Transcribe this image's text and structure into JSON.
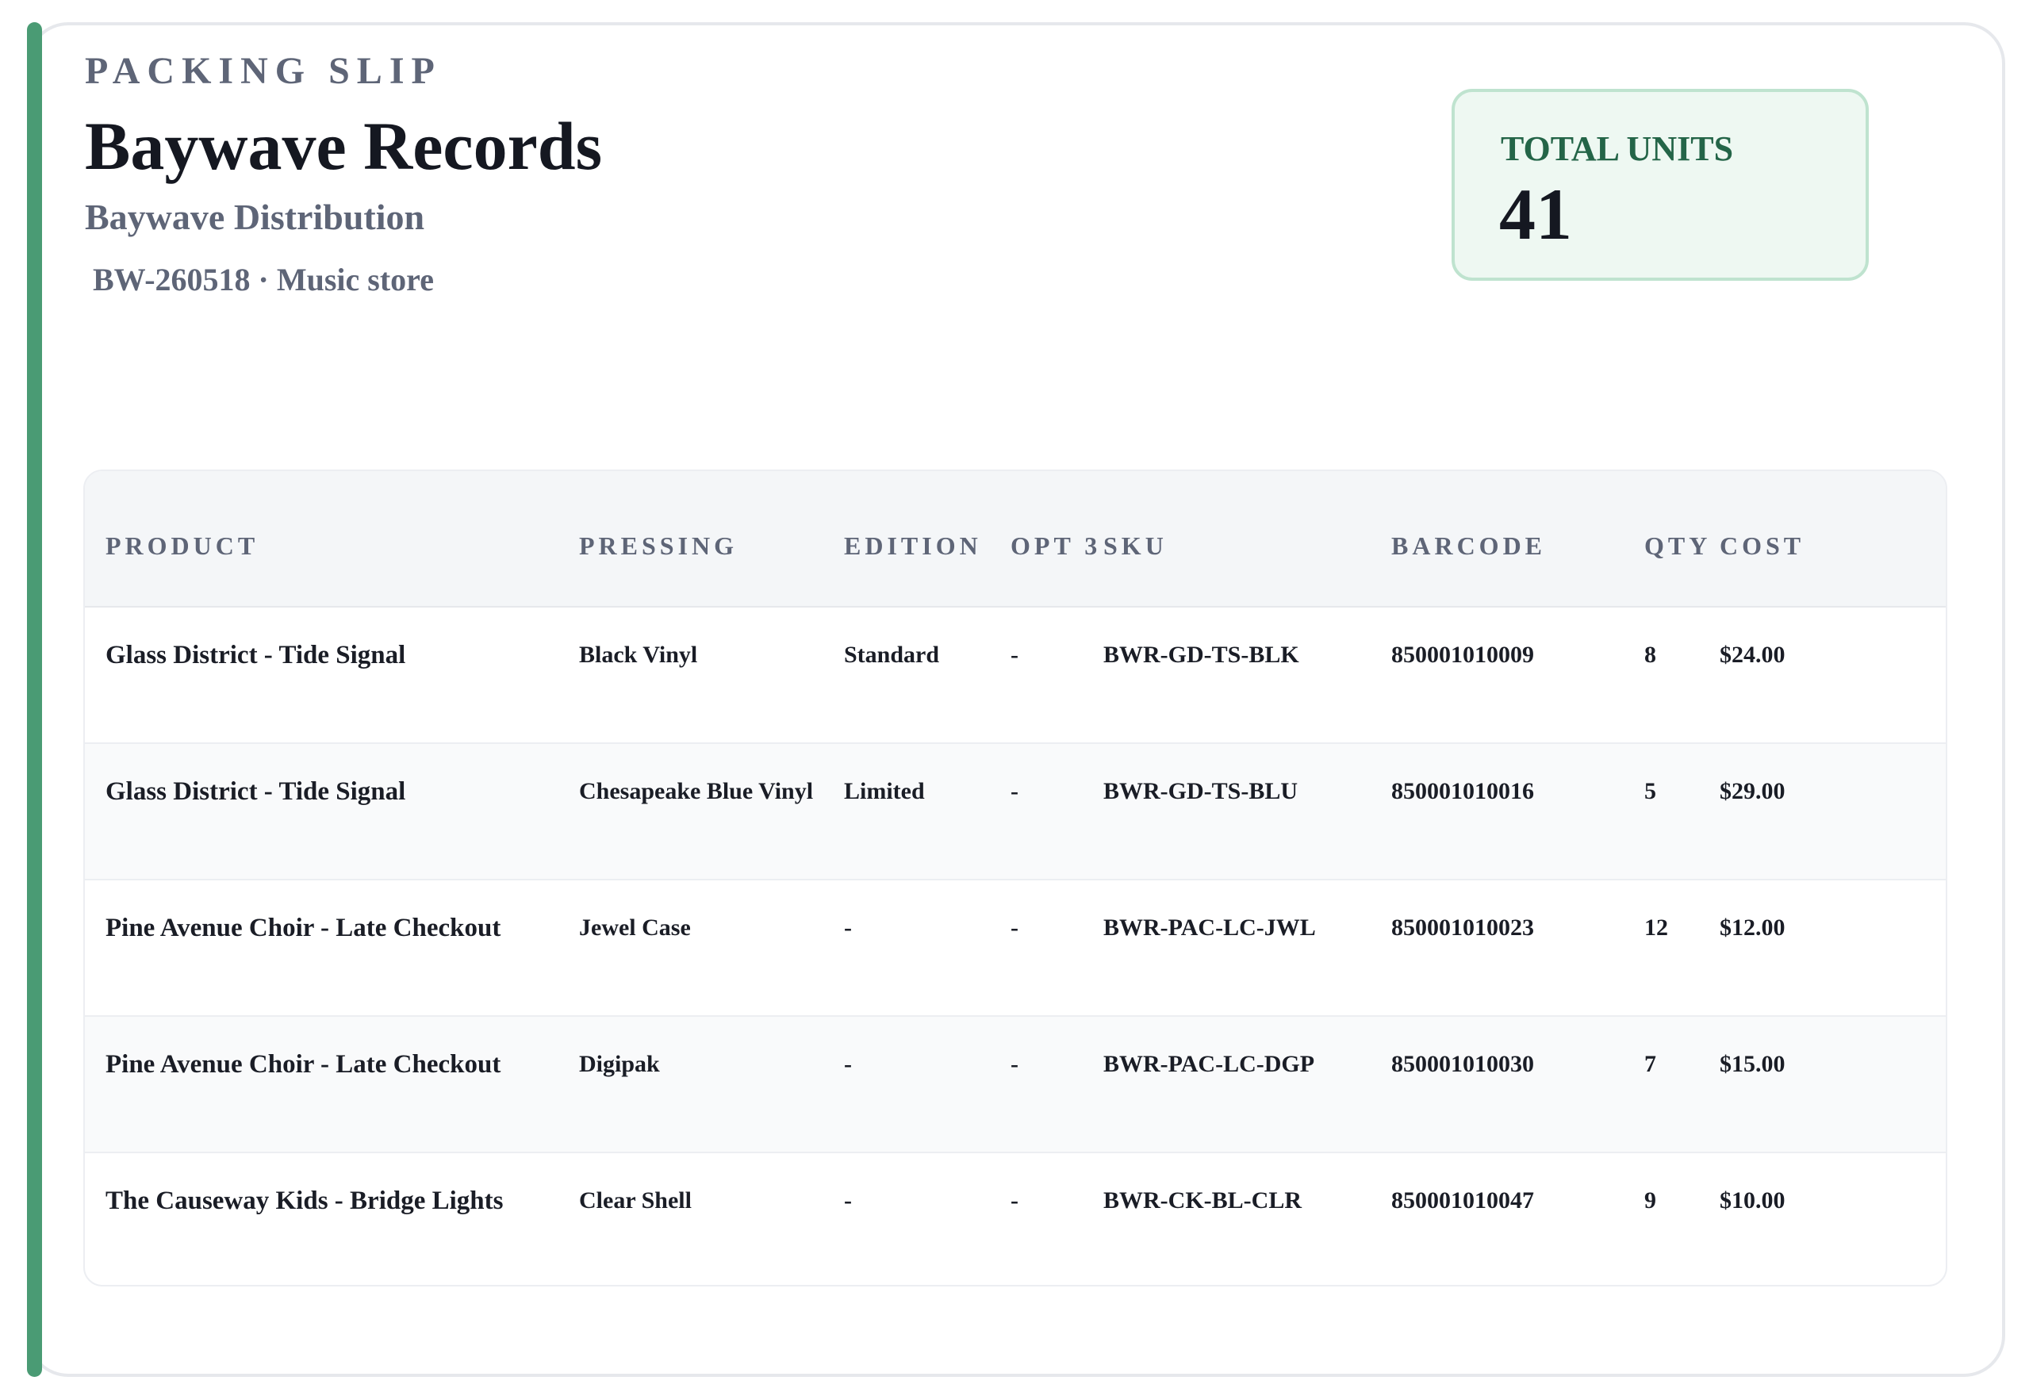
{
  "colors": {
    "accent": "#4a9b74",
    "total_box_bg": "#eef8f2",
    "total_label": "#246548"
  },
  "header": {
    "eyebrow": "PACKING SLIP",
    "title": "Baywave Records",
    "subtitle": "Baywave Distribution",
    "meta": "BW-260518 · Music store"
  },
  "total": {
    "label": "TOTAL UNITS",
    "value": "41"
  },
  "table": {
    "columns": {
      "product": "PRODUCT",
      "pressing": "PRESSING",
      "edition": "EDITION",
      "opt3": "OPT 3",
      "sku": "SKU",
      "barcode": "BARCODE",
      "qty": "QTY",
      "cost": "COST"
    },
    "rows": [
      {
        "product": "Glass District - Tide Signal",
        "pressing": "Black Vinyl",
        "edition": "Standard",
        "opt3": "-",
        "sku": "BWR-GD-TS-BLK",
        "barcode": "850001010009",
        "qty": "8",
        "cost": "$24.00"
      },
      {
        "product": "Glass District - Tide Signal",
        "pressing": "Chesapeake Blue Vinyl",
        "edition": "Limited",
        "opt3": "-",
        "sku": "BWR-GD-TS-BLU",
        "barcode": "850001010016",
        "qty": "5",
        "cost": "$29.00"
      },
      {
        "product": "Pine Avenue Choir - Late Checkout",
        "pressing": "Jewel Case",
        "edition": "-",
        "opt3": "-",
        "sku": "BWR-PAC-LC-JWL",
        "barcode": "850001010023",
        "qty": "12",
        "cost": "$12.00"
      },
      {
        "product": "Pine Avenue Choir - Late Checkout",
        "pressing": "Digipak",
        "edition": "-",
        "opt3": "-",
        "sku": "BWR-PAC-LC-DGP",
        "barcode": "850001010030",
        "qty": "7",
        "cost": "$15.00"
      },
      {
        "product": "The Causeway Kids - Bridge Lights",
        "pressing": "Clear Shell",
        "edition": "-",
        "opt3": "-",
        "sku": "BWR-CK-BL-CLR",
        "barcode": "850001010047",
        "qty": "9",
        "cost": "$10.00"
      }
    ]
  }
}
